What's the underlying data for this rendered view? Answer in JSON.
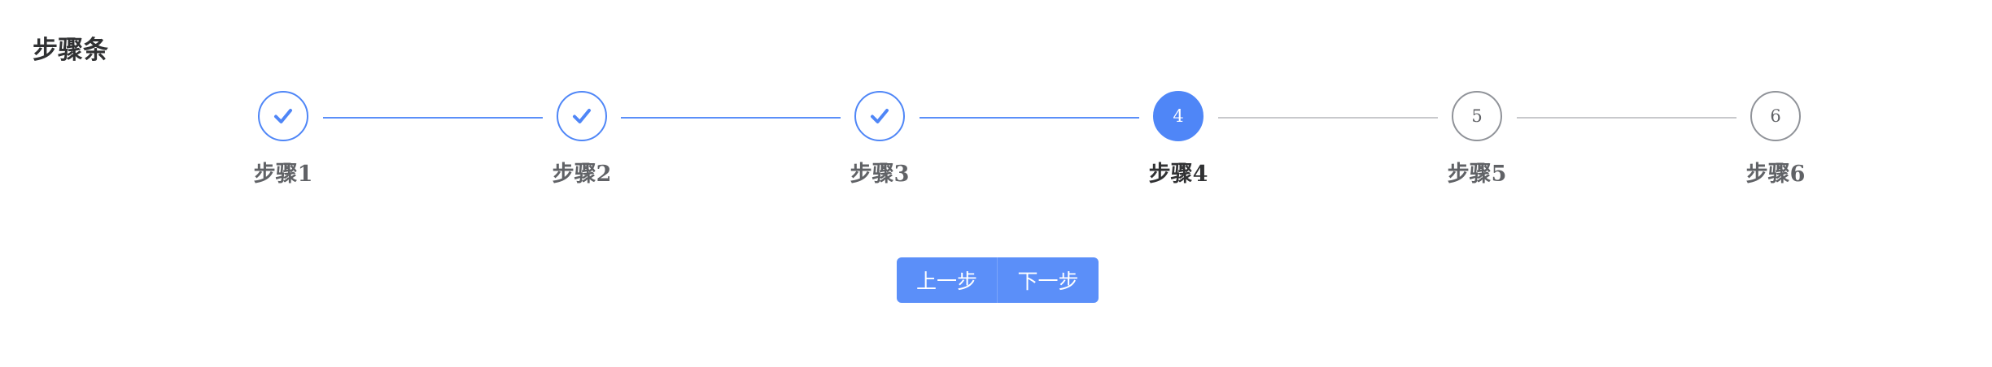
{
  "page_title": "步骤条",
  "steps": [
    {
      "label": "步骤1",
      "number": "1",
      "status": "finished",
      "icon": "check-icon"
    },
    {
      "label": "步骤2",
      "number": "2",
      "status": "finished",
      "icon": "check-icon"
    },
    {
      "label": "步骤3",
      "number": "3",
      "status": "finished",
      "icon": "check-icon"
    },
    {
      "label": "步骤4",
      "number": "4",
      "status": "active"
    },
    {
      "label": "步骤5",
      "number": "5",
      "status": "pending"
    },
    {
      "label": "步骤6",
      "number": "6",
      "status": "pending"
    }
  ],
  "buttons": {
    "prev_label": "上一步",
    "next_label": "下一步"
  },
  "colors": {
    "accent": "#4f86f7",
    "connector_done": "#5b8ff9",
    "connector_pending": "#c8c9cc"
  }
}
